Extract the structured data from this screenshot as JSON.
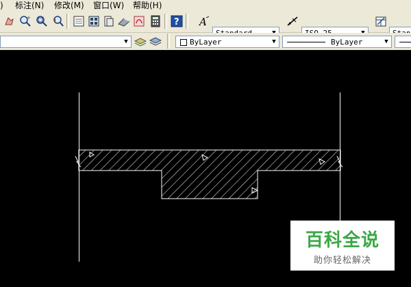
{
  "menu": {
    "items": [
      {
        "label": ")"
      },
      {
        "label": "标注(N)"
      },
      {
        "label": "修改(M)"
      },
      {
        "label": "窗口(W)"
      },
      {
        "label": "帮助(H)"
      }
    ]
  },
  "toolbar": {
    "text_style": "Standard",
    "dim_style": "ISO-25",
    "table_style": "Standa"
  },
  "properties": {
    "layer": "",
    "color": "ByLayer",
    "linetype": "ByLayer"
  },
  "watermark": {
    "title": "百科全说",
    "subtitle": "助你轻松解决"
  },
  "colors": {
    "toolbar_bg": "#ece9d8",
    "canvas_bg": "#000000",
    "drawing_lines": "#ffffff",
    "watermark_green": "#3aa845"
  }
}
